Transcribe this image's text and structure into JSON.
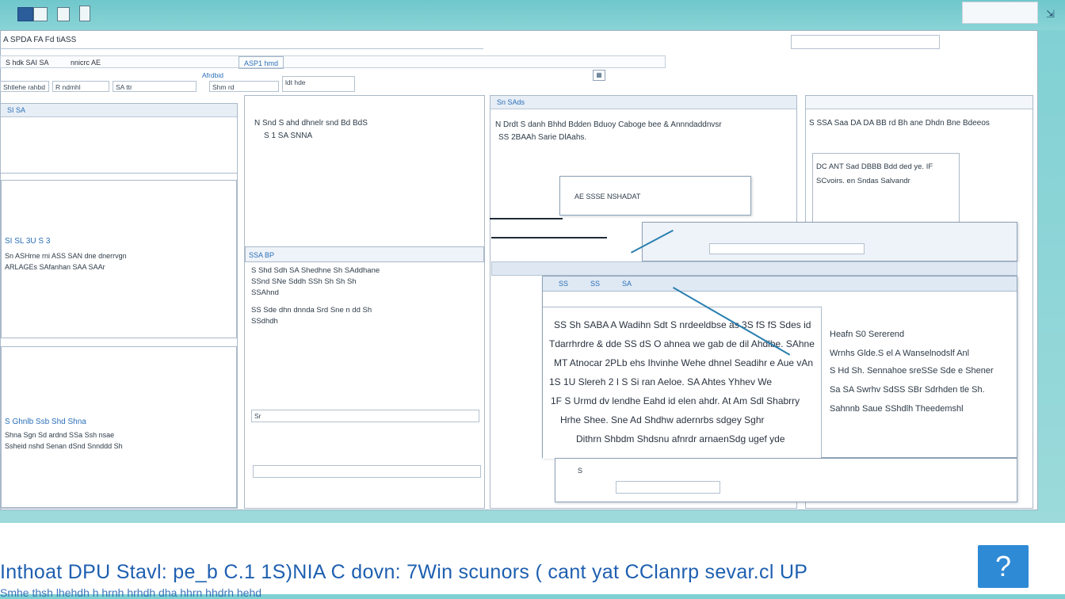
{
  "titlebar": {
    "icons": [
      "app-icon",
      "folder-icon",
      "image-icon",
      "document-icon"
    ],
    "top_right_box": "",
    "pin_glyph": "⇲"
  },
  "menubar": {
    "label": "A SPDA  FA Fd  tiASS"
  },
  "top_input": {
    "value": ""
  },
  "toolbar": {
    "tabs": [
      "S hdk SAI SA",
      "nnicrc  AE",
      "ASP1 hmd"
    ]
  },
  "filter_row": {
    "fields": [
      "Shtlehe rahbd",
      "R ndmhl",
      "SA ttr",
      "Afrdbid",
      "Shm rd",
      "ldt hde"
    ]
  },
  "left_column": {
    "header": "SI SA",
    "block1_title": "SI SL 3U S 3",
    "block1_lines": [
      "Sn ASHrne rni  ASS  SAN dne dnerrvgn",
      "ARLAGEs SAfanhan  SAA SAAr"
    ],
    "block2_title": "S Ghnlb Ssb Shd Shna",
    "block2_lines": [
      "Shna Sgn Sd ardnd  SSa  Ssh nsae",
      "Ssheid nshd Senan dSnd Snnddd Sh"
    ]
  },
  "col2": {
    "header": "",
    "line1": "N Snd S ahd dhnelr snd  Bd BdS",
    "line2": "S 1 SA SNNA",
    "sub_header": "SSA BP",
    "lines": [
      "S Shd Sdh SA Shedhne  Sh   SAddhane",
      "SSnd SNe Sddh SSh Sh Sh Sh",
      "SSAhnd",
      "SS Sde dhn dnnda Srd Sne n dd  Sh",
      "SSdhdh"
    ],
    "input_label": "Sr"
  },
  "col3": {
    "header": "Sn SAds",
    "line1": "N Drdt S danh  Bhhd Bdden  Bduoy Caboge bee & Annndaddnvsr",
    "line2": "SS 2BAAh Sarie DlAahs."
  },
  "col4": {
    "line1": "S  SSA Saa  DA DA BB rd Bh ane  Dhdn Bne Bdeeos",
    "inner_line1": "DC ANT Sad DBBB Bdd ded ye. IF",
    "inner_line2": "SCvoirs. en Sndas  Salvandr"
  },
  "dialog_small": {
    "label": "AE SSSE NSHADAT"
  },
  "dialog_main": {
    "tabs": [
      "SS",
      "SS",
      "SA"
    ],
    "lines": [
      "SS Sh SABA A Wadihn Sdt S nrdeeldbse as 3S fS fS Sdes id",
      "Tdarrhrdre & dde SS dS O ahnea  we gab de dil Ahdlbe.  SAhne",
      "MT Atnocar 2PLb  ehs Ihvinhe  Wehe dhnel Seadihr e Aue vAn",
      "1S 1U Slereh 2 I S Si ran Aeloe. SA Ahtes Yhhev We",
      "1F S Urmd dv lendhe  Eahd id elen  ahdr. At  Am Sdl Shabrry",
      "Hrhe Shee.  Sne  Ad Shdhw adernrbs sdgey  Sghr",
      "Dithrn  Shbdm  Shdsnu  afnrdr  arnaenSdg  ugef yde"
    ],
    "side_lines": [
      "Heafn  S0  Sererend",
      "Wrnhs  Glde.S el  A Wanselnodslf Anl",
      "S  Hd Sh. Sennahoe sreSSe Sde e  Shener",
      "Sa SA Swrhv SdSS SBr Sdrhden  tle Sh.",
      "Sahnnb  Saue SShdlh  Theedemshl"
    ],
    "bottom_field_label": "S"
  },
  "footer": {
    "main_text": "Inthoat DPU Stavl: pe_b C.1 1S)NIA C dovn: 7Win scunors ( cant yat CClanrp sevar.cl UP",
    "sub_text": "Smhe thsh  lhehdh h hrnh  hrhdh  dha  hhrn  hhdrh  hehd",
    "help_label": "?"
  },
  "colors": {
    "accent": "#2b6fb8",
    "help_button": "#2f8ad6",
    "teal_background": "#8ad4d6"
  }
}
